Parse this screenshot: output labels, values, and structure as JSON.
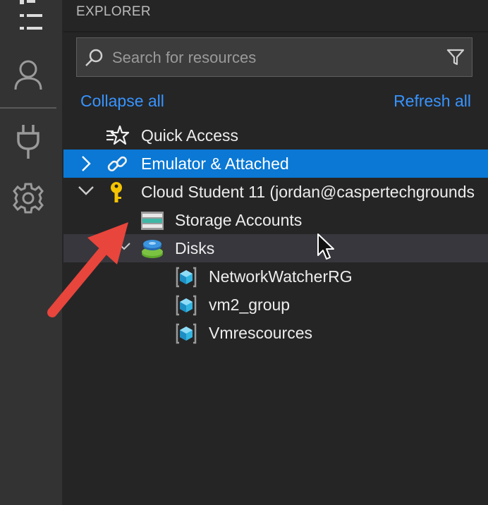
{
  "explorer": {
    "title": "EXPLORER",
    "search_placeholder": "Search for resources",
    "collapse_all": "Collapse all",
    "refresh_all": "Refresh all"
  },
  "tree": {
    "quick_access": "Quick Access",
    "emulator": "Emulator & Attached",
    "account": "Cloud Student 11 (jordan@caspertechgrounds",
    "storage_accounts": "Storage Accounts",
    "disks": "Disks",
    "groups": [
      "NetworkWatcherRG",
      "vm2_group",
      "Vmrescources"
    ]
  },
  "icons": {
    "activity": [
      "list-icon",
      "account-icon",
      "plug-icon",
      "gear-icon"
    ],
    "tree": [
      "quick-access-icon",
      "link-icon",
      "key-icon",
      "storage-icon",
      "disk-icon",
      "resource-group-icon"
    ]
  },
  "colors": {
    "selection": "#0a78d4",
    "link": "#3794ff",
    "annotation_arrow": "#e8453c"
  }
}
